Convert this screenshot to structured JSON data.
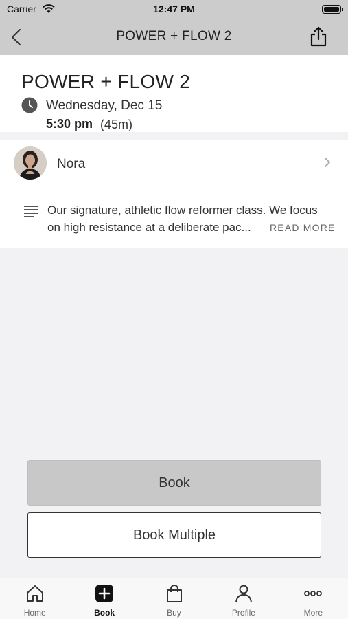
{
  "status_bar": {
    "carrier": "Carrier",
    "time": "12:47 PM"
  },
  "nav": {
    "title": "POWER + FLOW 2"
  },
  "class_info": {
    "title": "POWER + FLOW 2",
    "date": "Wednesday, Dec 15",
    "start_time": "5:30 pm",
    "duration": "(45m)"
  },
  "instructor": {
    "name": "Nora"
  },
  "description": {
    "line1": "Our signature, athletic flow reformer class. We focus",
    "line2": "on high resistance at a deliberate pac...",
    "read_more": "READ MORE"
  },
  "buttons": {
    "book": "Book",
    "book_multiple": "Book Multiple"
  },
  "tabs": [
    {
      "label": "Home",
      "icon": "home-icon"
    },
    {
      "label": "Book",
      "icon": "plus-square-icon",
      "active": true
    },
    {
      "label": "Buy",
      "icon": "shopping-bag-icon"
    },
    {
      "label": "Profile",
      "icon": "person-icon"
    },
    {
      "label": "More",
      "icon": "ellipsis-icon"
    }
  ],
  "colors": {
    "nav_background": "#cccccc",
    "book_button": "#c8c8c8",
    "page_background": "#f2f2f4"
  }
}
